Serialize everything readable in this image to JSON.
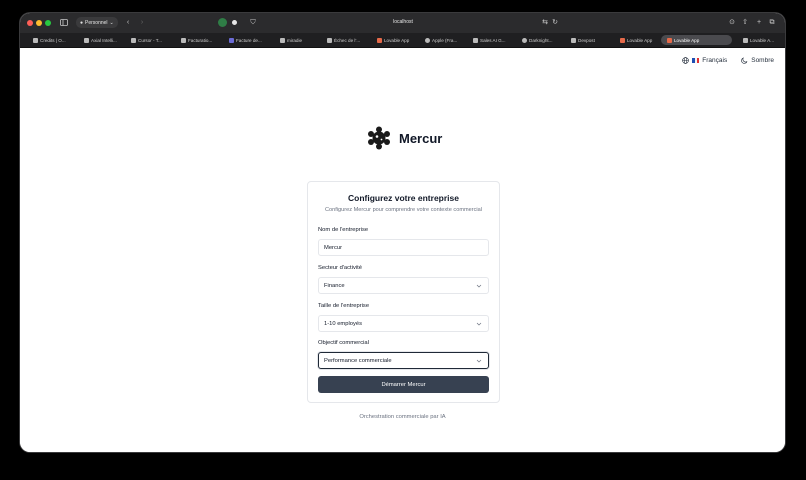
{
  "browser": {
    "profile_label": "Personnel",
    "address": "localhost",
    "tabs": [
      {
        "label": "Credits | O..."
      },
      {
        "label": "Axial Intelli..."
      },
      {
        "label": "Cursor - T..."
      },
      {
        "label": "Facturatio..."
      },
      {
        "label": "Facture de..."
      },
      {
        "label": "miradie"
      },
      {
        "label": "Échec de l'..."
      },
      {
        "label": "Lovable App"
      },
      {
        "label": "Apple (Fra..."
      },
      {
        "label": "Sales AI G..."
      },
      {
        "label": "Darknight..."
      },
      {
        "label": "Devpost"
      },
      {
        "label": "Lovable App"
      },
      {
        "label": "Lovable App"
      },
      {
        "label": "Lovable A..."
      }
    ]
  },
  "header": {
    "language_label": "Français",
    "theme_label": "Sombre"
  },
  "brand": {
    "name": "Mercur"
  },
  "form": {
    "title": "Configurez votre entreprise",
    "subtitle": "Configurez Mercur pour comprendre votre contexte commercial",
    "company_name": {
      "label": "Nom de l'entreprise",
      "value": "Mercur"
    },
    "sector": {
      "label": "Secteur d'activité",
      "value": "Finance"
    },
    "size": {
      "label": "Taille de l'entreprise",
      "value": "1-10 employés"
    },
    "objective": {
      "label": "Objectif commercial",
      "value": "Performance commerciale"
    },
    "submit_label": "Démarrer Mercur"
  },
  "footer": {
    "tagline": "Orchestration commerciale par IA"
  },
  "colors": {
    "primary_button": "#374151",
    "text": "#111827",
    "muted": "#6b7280"
  }
}
